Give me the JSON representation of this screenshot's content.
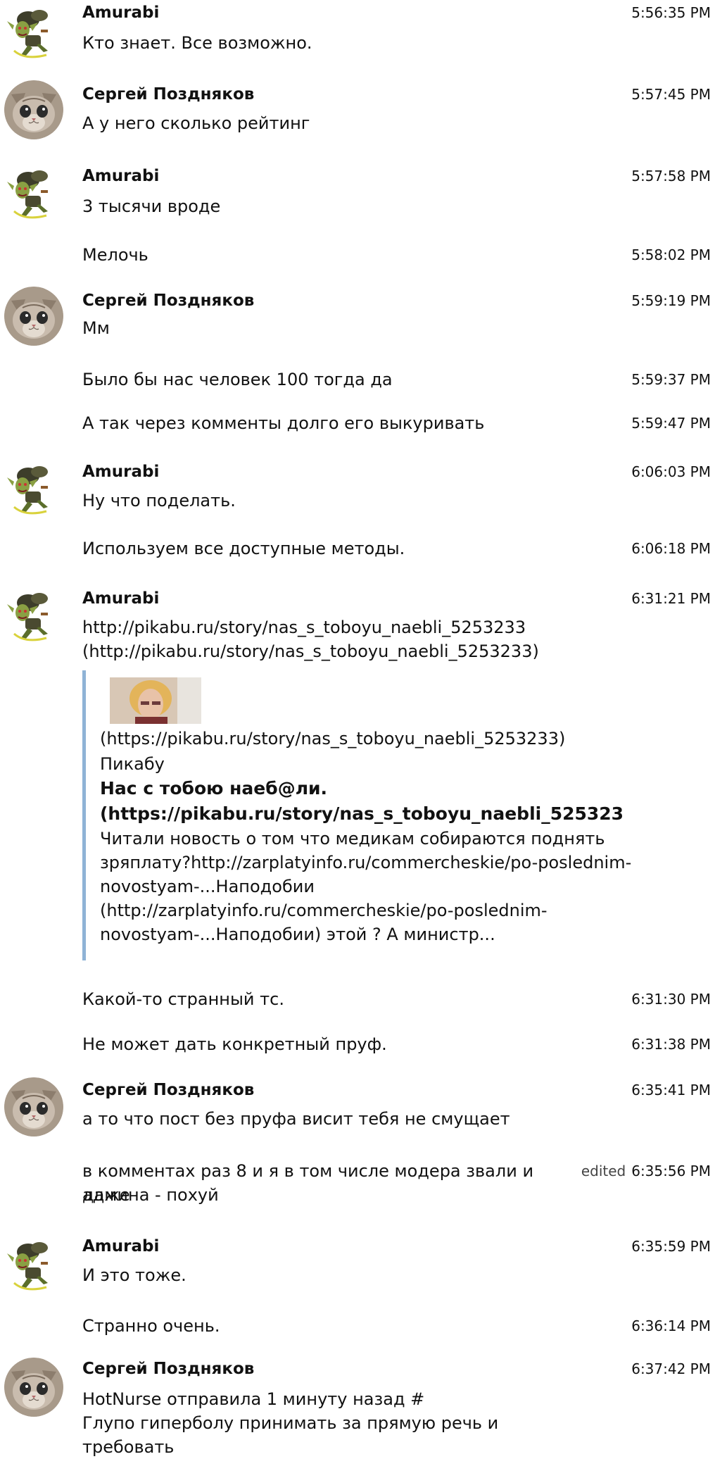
{
  "messages": [
    {
      "author": "Amurabi",
      "avatar": "goblin-avatar",
      "time": "5:56:35 PM",
      "text": "Кто знает. Все возможно."
    },
    {
      "author": "Сергей Поздняков",
      "avatar": "cat-avatar",
      "time": "5:57:45 PM",
      "text": "А у него сколько рейтинг"
    },
    {
      "author": "Amurabi",
      "avatar": "goblin-avatar",
      "time": "5:57:58 PM",
      "text": "3 тысячи вроде"
    },
    {
      "time": "5:58:02 PM",
      "text": "Мелочь"
    },
    {
      "author": "Сергей Поздняков",
      "avatar": "cat-avatar",
      "time": "5:59:19 PM",
      "text": "Мм"
    },
    {
      "time": "5:59:37 PM",
      "text": "Было бы нас человек 100 тогда да"
    },
    {
      "time": "5:59:47 PM",
      "text": "А так через комменты долго его выкуривать"
    },
    {
      "author": "Amurabi",
      "avatar": "goblin-avatar",
      "time": "6:06:03 PM",
      "text": "Ну что поделать."
    },
    {
      "time": "6:06:18 PM",
      "text": "Используем все доступные методы."
    },
    {
      "author": "Amurabi",
      "avatar": "goblin-avatar",
      "time": "6:31:21 PM",
      "text_line1": "http://pikabu.ru/story/nas_s_toboyu_naebli_5253233",
      "text_line2": "(http://pikabu.ru/story/nas_s_toboyu_naebli_5253233)",
      "preview": {
        "thumb_link": "(https://pikabu.ru/story/nas_s_toboyu_naebli_5253233)",
        "site": "Пикабу",
        "title_line1": "Нас с тобою наеб@ли.",
        "title_line2": "(https://pikabu.ru/story/nas_s_toboyu_naebli_525323",
        "desc_line1": "Читали новость о том что медикам собираются поднять",
        "desc_line2": "зряплату?http://zarplatyinfo.ru/commercheskie/po-poslednim-",
        "desc_line3": "novostyam-...Наподобии",
        "desc_line4": "(http://zarplatyinfo.ru/commercheskie/po-poslednim-",
        "desc_line5": "novostyam-...Наподобии) этой ? А министр..."
      }
    },
    {
      "time": "6:31:30 PM",
      "text": "Какой-то странный тс."
    },
    {
      "time": "6:31:38 PM",
      "text": "Не может дать конкретный пруф."
    },
    {
      "author": "Сергей Поздняков",
      "avatar": "cat-avatar",
      "time": "6:35:41 PM",
      "text": "а то что пост без пруфа висит тебя не смущает"
    },
    {
      "edited": "edited",
      "time": "6:35:56 PM",
      "text_line1": "в комментах раз 8 и я в том числе модера звали и даже",
      "text_line2": "админа - похуй"
    },
    {
      "author": "Amurabi",
      "avatar": "goblin-avatar",
      "time": "6:35:59 PM",
      "text": "И это тоже."
    },
    {
      "time": "6:36:14 PM",
      "text": "Странно очень."
    },
    {
      "author": "Сергей Поздняков",
      "avatar": "cat-avatar",
      "time": "6:37:42 PM",
      "text_line1": "HotNurse отправила 1 минуту назад #",
      "text_line2": "Глупо гиперболу принимать за прямую речь и требовать"
    }
  ]
}
